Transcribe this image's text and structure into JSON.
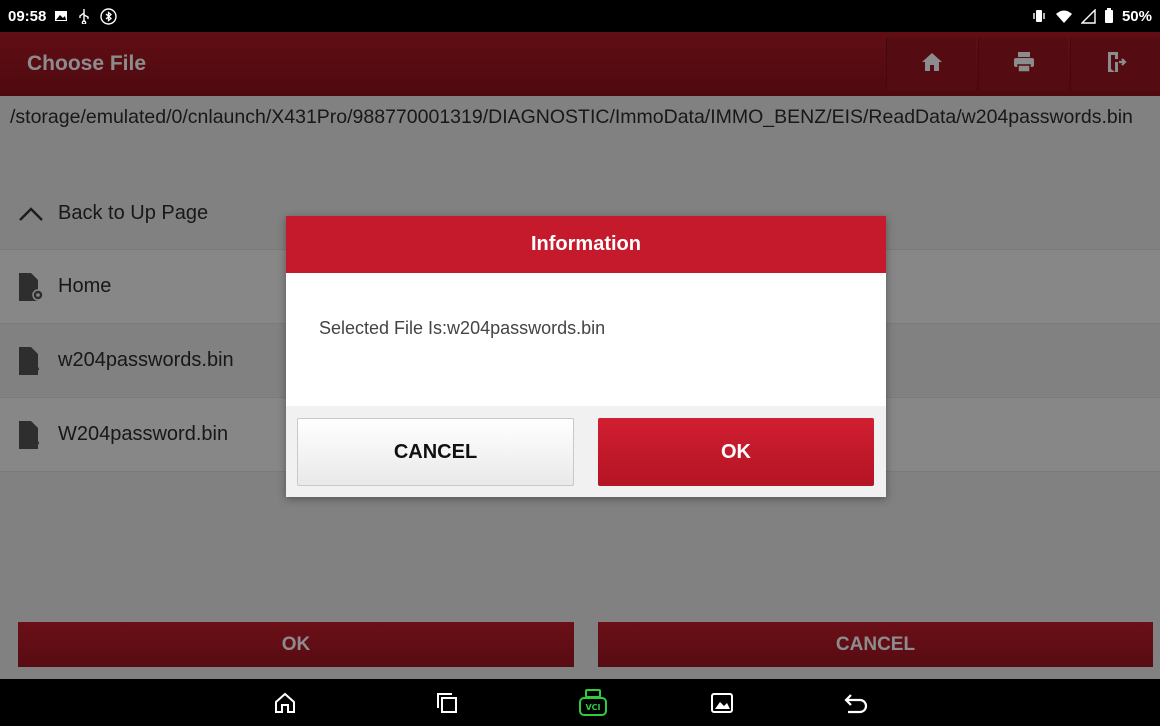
{
  "status_bar": {
    "time": "09:58",
    "battery": "50%",
    "left_icons": [
      "image-icon",
      "usb-icon",
      "bluetooth-icon"
    ],
    "right_icons": [
      "vibrate-icon",
      "wifi-icon",
      "signal-icon",
      "battery-icon"
    ]
  },
  "header": {
    "title": "Choose File",
    "tools": [
      "home-icon",
      "print-icon",
      "exit-icon"
    ]
  },
  "path": "/storage/emulated/0/cnlaunch/X431Pro/988770001319/DIAGNOSTIC/ImmoData/IMMO_BENZ/EIS/ReadData/w204passwords.bin",
  "list": {
    "back_label": "Back to Up Page",
    "items": [
      {
        "label": "Home",
        "icon": "folder-settings-icon"
      },
      {
        "label": "w204passwords.bin",
        "icon": "unknown-file-icon"
      },
      {
        "label": "W204password.bin",
        "icon": "unknown-file-icon"
      }
    ]
  },
  "bottom": {
    "ok_label": "OK",
    "cancel_label": "CANCEL"
  },
  "dialog": {
    "title": "Information",
    "message": "Selected File Is:w204passwords.bin",
    "cancel_label": "CANCEL",
    "ok_label": "OK"
  },
  "navbar": {
    "icons": [
      "home-icon",
      "recents-icon",
      "vci-icon",
      "gallery-icon",
      "back-icon"
    ]
  },
  "colors": {
    "accent": "#c51a2b",
    "header": "#9a1520",
    "vci_green": "#2ecc40"
  }
}
